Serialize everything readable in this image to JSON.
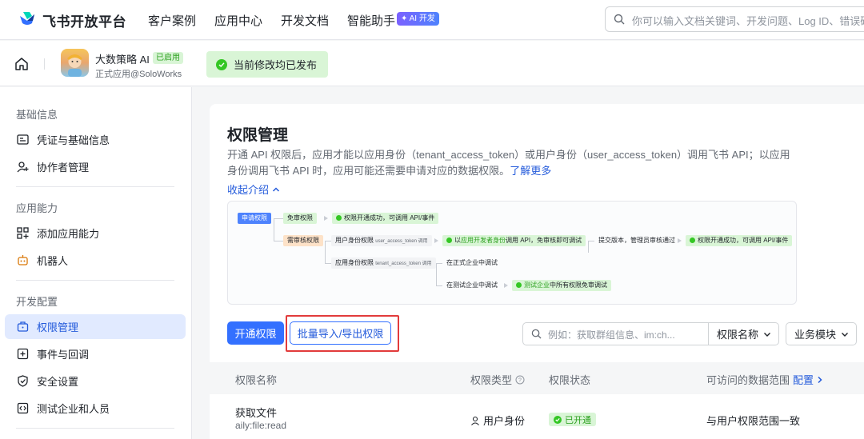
{
  "topnav": {
    "brand": "飞书开放平台",
    "items": [
      "客户案例",
      "应用中心",
      "开发文档",
      "智能助手"
    ],
    "ai_badge": "AI 开发",
    "search_placeholder": "你可以输入文档关键词、开发问题、Log ID、错误码"
  },
  "appbar": {
    "app_name": "大数策略 AI",
    "status_badge": "已启用",
    "app_sub": "正式应用@SoloWorks",
    "published_notice": "当前修改均已发布"
  },
  "sidebar": {
    "sections": [
      {
        "title": "基础信息",
        "items": [
          "凭证与基础信息",
          "协作者管理"
        ]
      },
      {
        "title": "应用能力",
        "items": [
          "添加应用能力",
          "机器人"
        ]
      },
      {
        "title": "开发配置",
        "items": [
          "权限管理",
          "事件与回调",
          "安全设置",
          "测试企业和人员"
        ]
      }
    ],
    "active_item": "权限管理"
  },
  "main": {
    "title": "权限管理",
    "intro": "开通 API 权限后，应用才能以应用身份（tenant_access_token）或用户身份（user_access_token）调用飞书 API；以应用身份调用飞书 API 时，应用可能还需要申请对应的数据权限。",
    "learn_more": "了解更多",
    "collapse_label": "收起介绍",
    "flow": {
      "apply": "申请权限",
      "no_review": "免审权限",
      "no_review_result": "权限开通成功，可调用 API/事件",
      "review": "需审核权限",
      "user_identity": "用户身份权限",
      "user_identity_note": "user_access_token 调用",
      "user_dev_prefix": "以",
      "user_dev_hl": "应用开发者身份",
      "user_dev_suffix": "调用 API，免审核即可调试",
      "submit": "提交版本，管理员审核通过",
      "final_result": "权限开通成功，可调用 API/事件",
      "app_identity": "应用身份权限",
      "app_identity_note": "tenant_access_token 调用",
      "formal_debug": "在正式企业中调试",
      "test_debug": "在测试企业中调试",
      "test_hl": "测试企业",
      "test_suffix": "中所有权限免审调试"
    },
    "buttons": {
      "open": "开通权限",
      "batch": "批量导入/导出权限"
    },
    "filter": {
      "search_placeholder": "例如：获取群组信息、im:ch...",
      "select_name": "权限名称",
      "select_module": "业务模块"
    },
    "table": {
      "headers": [
        "权限名称",
        "权限类型",
        "权限状态",
        "可访问的数据范围"
      ],
      "config_link": "配置",
      "rows": [
        {
          "name": "获取文件",
          "code": "aily:file:read",
          "type": "用户身份",
          "status": "已开通",
          "scope": "与用户权限范围一致"
        }
      ]
    }
  }
}
